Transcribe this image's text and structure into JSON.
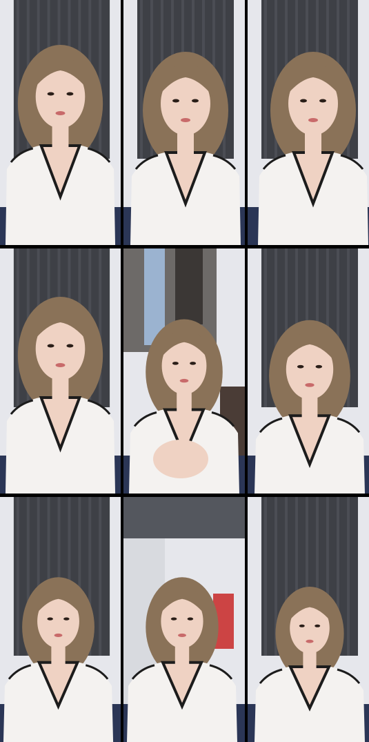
{
  "grid": {
    "rows": 3,
    "columns": 3,
    "tiles": [
      {
        "scene": "curtain",
        "pose": "tilt-left"
      },
      {
        "scene": "curtain",
        "pose": "pout"
      },
      {
        "scene": "curtain",
        "pose": "look-side"
      },
      {
        "scene": "curtain",
        "pose": "front"
      },
      {
        "scene": "closet",
        "pose": "hands"
      },
      {
        "scene": "curtain",
        "pose": "front-close"
      },
      {
        "scene": "curtain",
        "pose": "low-angle"
      },
      {
        "scene": "room",
        "pose": "low-angle"
      },
      {
        "scene": "curtain",
        "pose": "surprised"
      }
    ]
  },
  "colors": {
    "curtain": "#3e4046",
    "wall": "#e6e7ec",
    "shirt": "#f4f2f0",
    "trim": "#1c1c1c",
    "skin": "#efd2c3",
    "hair": "#8a7258",
    "sofa": "#2b3656"
  }
}
